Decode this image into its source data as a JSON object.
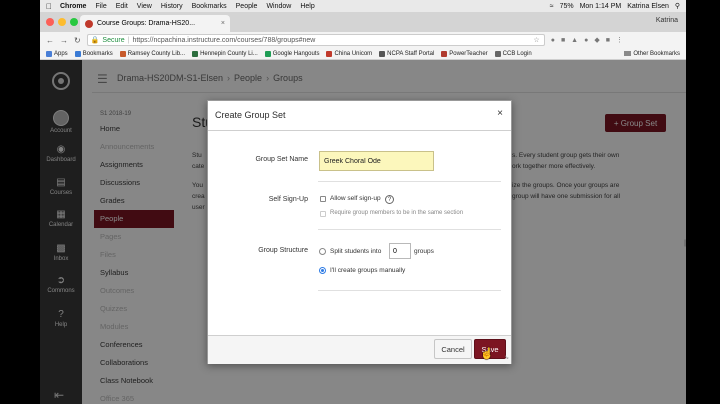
{
  "mac_menu": {
    "app": "Chrome",
    "items": [
      "File",
      "Edit",
      "View",
      "History",
      "Bookmarks",
      "People",
      "Window",
      "Help"
    ],
    "battery": "75%",
    "clock": "Mon 1:14 PM",
    "user": "Katrina Elsen"
  },
  "browser": {
    "tab_title": "Course Groups: Drama-HS20...",
    "profile_name": "Katrina",
    "secure_label": "Secure",
    "url": "https://ncpachina.instructure.com/courses/788/groups#new",
    "bookmarks": [
      {
        "label": "Apps",
        "color": "#4a7fd6"
      },
      {
        "label": "Bookmarks",
        "color": "#3a7bd5"
      },
      {
        "label": "Ramsey County Lib...",
        "color": "#c85a2b"
      },
      {
        "label": "Hennepin County Li...",
        "color": "#2d6e3e"
      },
      {
        "label": "Google Hangouts",
        "color": "#1f9d55"
      },
      {
        "label": "China Unicom",
        "color": "#c0392b"
      },
      {
        "label": "NCPA Staff Portal",
        "color": "#555555"
      },
      {
        "label": "PowerTeacher",
        "color": "#b03a2e"
      },
      {
        "label": "CCB Login",
        "color": "#666666"
      }
    ],
    "other_bookmarks": "Other Bookmarks"
  },
  "global_nav": {
    "account": "Account",
    "dashboard": "Dashboard",
    "courses": "Courses",
    "calendar": "Calendar",
    "inbox": "Inbox",
    "commons": "Commons",
    "help": "Help"
  },
  "breadcrumb": {
    "course": "Drama-HS20DM-S1-Elsen",
    "section": "People",
    "page": "Groups"
  },
  "course_nav": {
    "term": "S1 2018-19",
    "items": [
      {
        "label": "Home",
        "state": "normal"
      },
      {
        "label": "Announcements",
        "state": "dim"
      },
      {
        "label": "Assignments",
        "state": "normal"
      },
      {
        "label": "Discussions",
        "state": "normal"
      },
      {
        "label": "Grades",
        "state": "normal"
      },
      {
        "label": "People",
        "state": "active"
      },
      {
        "label": "Pages",
        "state": "dim"
      },
      {
        "label": "Files",
        "state": "dim"
      },
      {
        "label": "Syllabus",
        "state": "normal"
      },
      {
        "label": "Outcomes",
        "state": "dim"
      },
      {
        "label": "Quizzes",
        "state": "dim"
      },
      {
        "label": "Modules",
        "state": "dim"
      },
      {
        "label": "Conferences",
        "state": "normal"
      },
      {
        "label": "Collaborations",
        "state": "normal"
      },
      {
        "label": "Class Notebook",
        "state": "normal"
      },
      {
        "label": "Office 365",
        "state": "dim"
      }
    ]
  },
  "main": {
    "title": "Stu",
    "add_button": "+ Group Set",
    "para_left_1": "Stu",
    "para_left_2": "cate",
    "para_left_3": "You",
    "para_left_4": "crea",
    "para_left_5": "user",
    "para_right_1": "s. Every student group gets their own",
    "para_right_2": "ork together more effectively.",
    "para_right_3": "ize the groups. Once your groups are",
    "para_right_4": "group will have one submission for all"
  },
  "dialog": {
    "title": "Create Group Set",
    "close": "×",
    "name_label": "Group Set Name",
    "name_value": "Greek Choral Ode",
    "signup_label": "Self Sign-Up",
    "allow_signup": "Allow self sign-up",
    "require_section": "Require group members to be in the same section",
    "structure_label": "Group Structure",
    "split_prefix": "Split students into",
    "split_value": "0",
    "split_suffix": "groups",
    "manual": "I'll create groups manually",
    "cancel": "Cancel",
    "save": "Save"
  }
}
